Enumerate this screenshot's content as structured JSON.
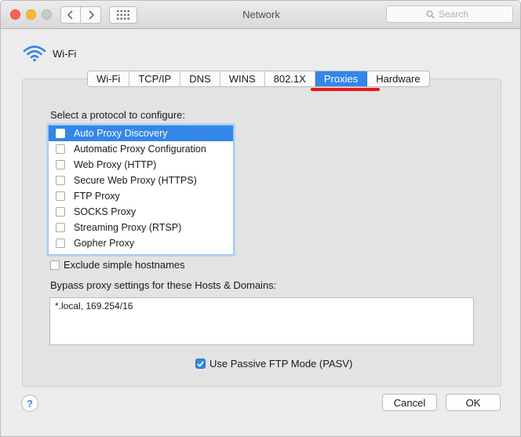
{
  "window": {
    "title": "Network"
  },
  "search": {
    "placeholder": "Search"
  },
  "service": {
    "name": "Wi-Fi"
  },
  "tabs": [
    {
      "label": "Wi-Fi"
    },
    {
      "label": "TCP/IP"
    },
    {
      "label": "DNS"
    },
    {
      "label": "WINS"
    },
    {
      "label": "802.1X"
    },
    {
      "label": "Proxies"
    },
    {
      "label": "Hardware"
    }
  ],
  "active_tab": "Proxies",
  "protocols": {
    "prompt": "Select a protocol to configure:",
    "items": [
      {
        "label": "Auto Proxy Discovery",
        "checked": false,
        "selected": true
      },
      {
        "label": "Automatic Proxy Configuration",
        "checked": false,
        "selected": false
      },
      {
        "label": "Web Proxy (HTTP)",
        "checked": false,
        "selected": false
      },
      {
        "label": "Secure Web Proxy (HTTPS)",
        "checked": false,
        "selected": false
      },
      {
        "label": "FTP Proxy",
        "checked": false,
        "selected": false
      },
      {
        "label": "SOCKS Proxy",
        "checked": false,
        "selected": false
      },
      {
        "label": "Streaming Proxy (RTSP)",
        "checked": false,
        "selected": false
      },
      {
        "label": "Gopher Proxy",
        "checked": false,
        "selected": false
      }
    ]
  },
  "exclude_simple": {
    "label": "Exclude simple hostnames",
    "checked": false
  },
  "bypass": {
    "label": "Bypass proxy settings for these Hosts & Domains:",
    "value": "*.local, 169.254/16"
  },
  "passive_ftp": {
    "label": "Use Passive FTP Mode (PASV)",
    "checked": true
  },
  "buttons": {
    "help": "?",
    "cancel": "Cancel",
    "ok": "OK"
  },
  "colors": {
    "accent": "#3486e8",
    "annotation": "#e8141c"
  }
}
